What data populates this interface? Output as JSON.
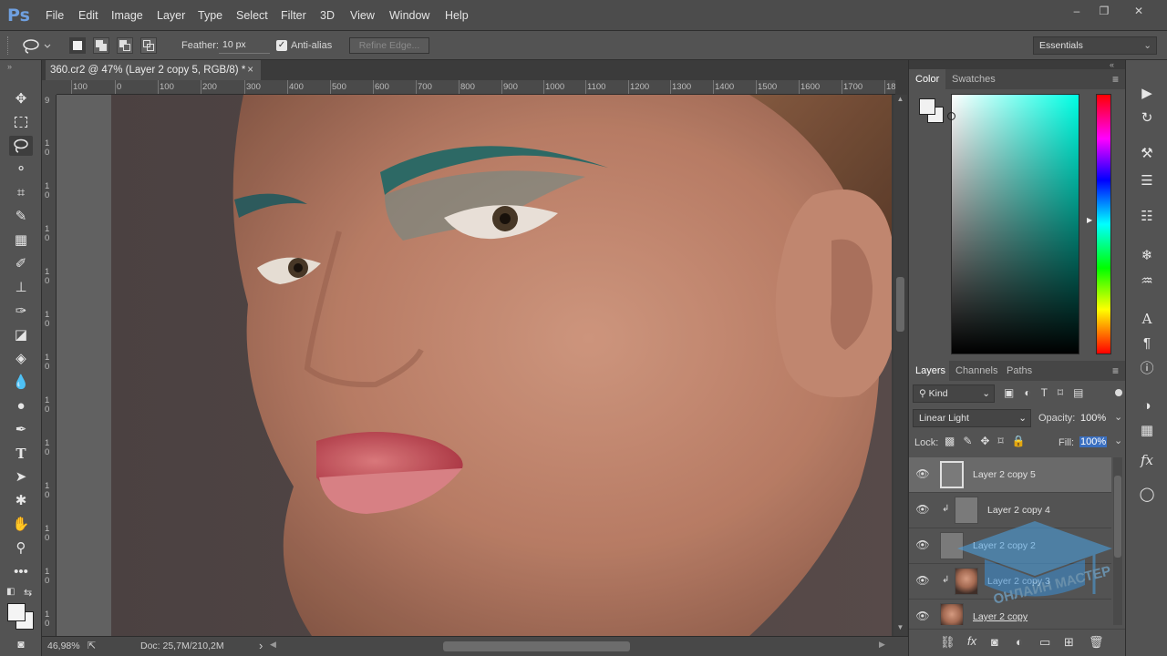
{
  "app": {
    "logo": "Ps",
    "workspace": "Essentials"
  },
  "menu": [
    "File",
    "Edit",
    "Image",
    "Layer",
    "Type",
    "Select",
    "Filter",
    "3D",
    "View",
    "Window",
    "Help"
  ],
  "window_controls": {
    "minimize": "‒",
    "restore": "❐",
    "close": "✕"
  },
  "options": {
    "feather_label": "Feather:",
    "feather_value": "10 px",
    "antialias_label": "Anti-alias",
    "refine_edge": "Refine Edge..."
  },
  "document": {
    "tab_title": "360.cr2 @ 47% (Layer 2 copy 5, RGB/8) *",
    "close": "×"
  },
  "ruler": {
    "h_ticks": [
      "100",
      "0",
      "100",
      "200",
      "300",
      "400",
      "500",
      "600",
      "700",
      "800",
      "900",
      "1000",
      "1100",
      "1200",
      "1300",
      "1400",
      "1500",
      "1600",
      "1700",
      "18"
    ],
    "v_ticks": [
      "9",
      "1\n0",
      "1\n0",
      "1\n0",
      "1\n0",
      "1\n0",
      "1\n0",
      "1\n0",
      "1\n0",
      "1\n0",
      "1\n0",
      "1\n0",
      "1\n0"
    ]
  },
  "status": {
    "zoom": "46,98%",
    "doc": "Doc: 25,7M/210,2M",
    "arrow": "›"
  },
  "color_panel": {
    "tabs": [
      "Color",
      "Swatches"
    ],
    "hue_color": "#00ffe4"
  },
  "layers_panel": {
    "tabs": [
      "Layers",
      "Channels",
      "Paths"
    ],
    "kind_label": "Kind",
    "blend_mode": "Linear Light",
    "opacity_label": "Opacity:",
    "opacity_value": "100%",
    "lock_label": "Lock:",
    "fill_label": "Fill:",
    "fill_value": "100%",
    "layers": [
      {
        "name": "Layer 2 copy 5",
        "selected": true,
        "clipped": false,
        "thumb": "gray"
      },
      {
        "name": "Layer 2 copy 4",
        "selected": false,
        "clipped": true,
        "thumb": "gray"
      },
      {
        "name": "Layer 2 copy 2",
        "selected": false,
        "clipped": false,
        "thumb": "gray"
      },
      {
        "name": "Layer 2 copy 3",
        "selected": false,
        "clipped": true,
        "thumb": "photo"
      },
      {
        "name": "Layer 2 copy",
        "selected": false,
        "clipped": false,
        "thumb": "photo"
      }
    ]
  },
  "watermark": "ОНЛАЙН МАСТЕР"
}
